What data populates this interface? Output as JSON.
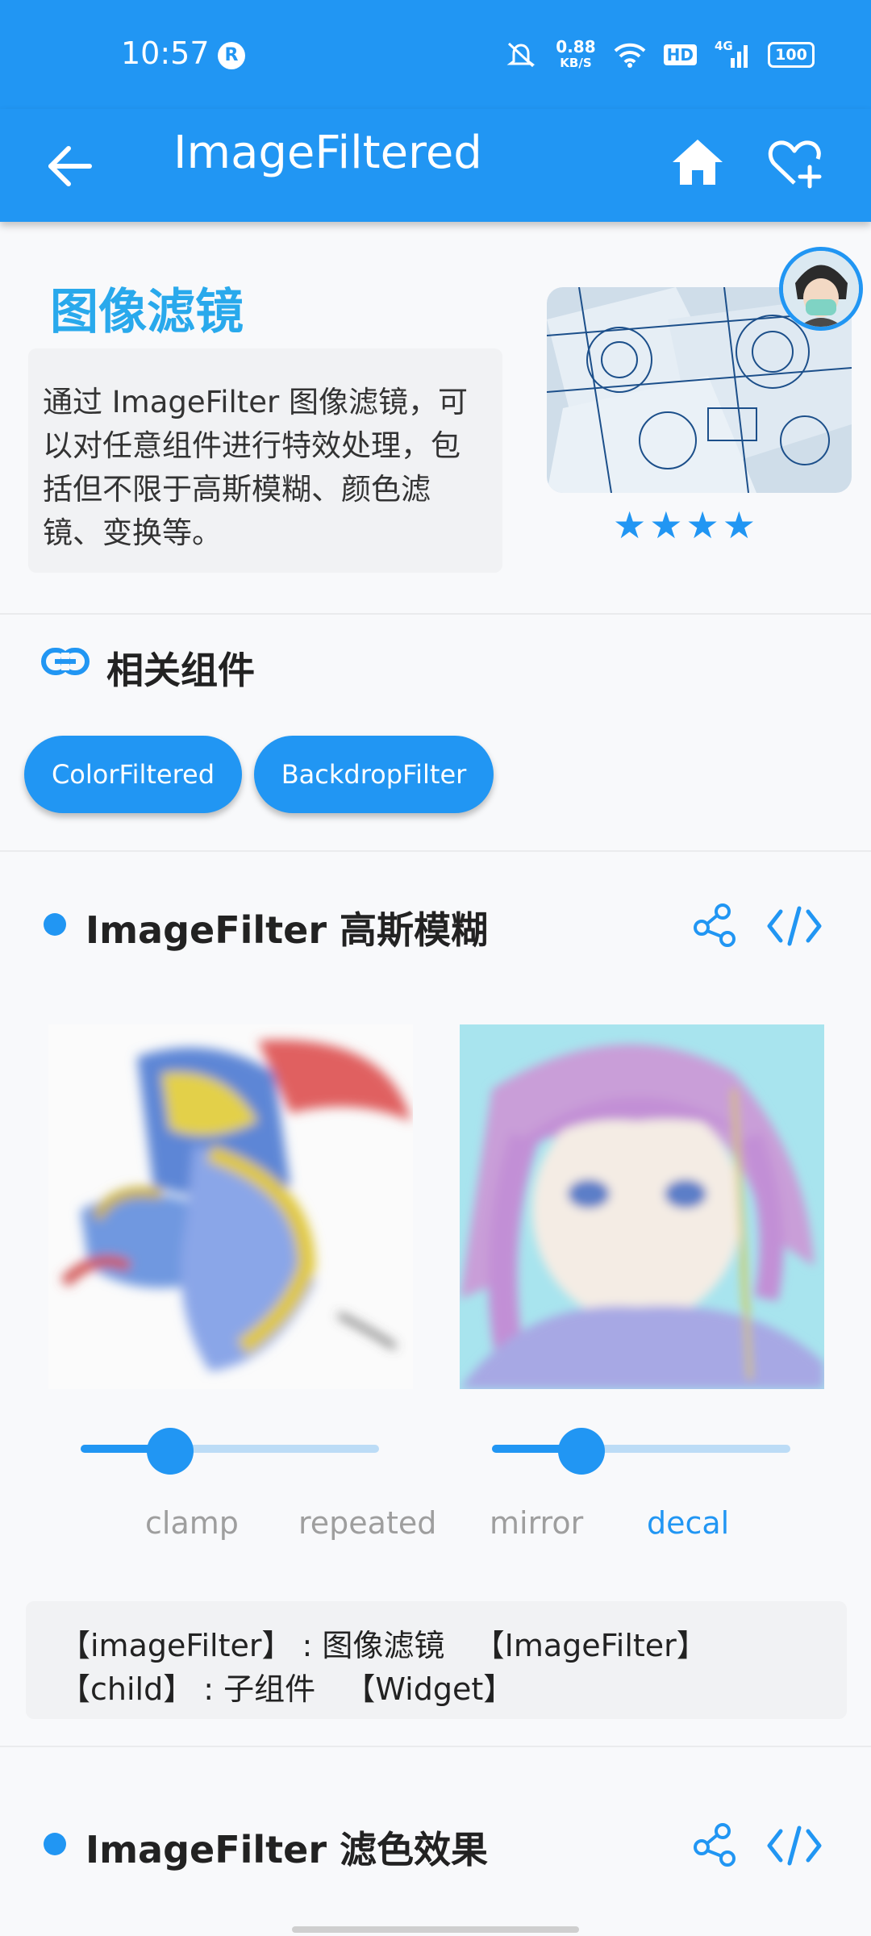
{
  "status_bar": {
    "time": "10:57",
    "net_speed_value": "0.88",
    "net_speed_unit": "KB/S",
    "hd": "HD",
    "signal": "4G",
    "battery": "100"
  },
  "app_bar": {
    "title": "ImageFiltered",
    "back_icon": "arrow-back-icon",
    "home_icon": "home-icon",
    "favorite_icon": "heart-add-icon"
  },
  "intro": {
    "title": "图像滤镜",
    "description": "通过 ImageFilter 图像滤镜，可以对任意组件进行特效处理，包括但不限于高斯模糊、颜色滤镜、变换等。",
    "rating": 4
  },
  "related": {
    "title": "相关组件",
    "chips": [
      "ColorFiltered",
      "BackdropFilter"
    ]
  },
  "demo1": {
    "title": "ImageFilter 高斯模糊",
    "slider_left_value": 0.3,
    "slider_right_value": 0.3,
    "modes": [
      "clamp",
      "repeated",
      "mirror",
      "decal"
    ],
    "active_mode": "decal",
    "props": [
      "【imageFilter】 : 图像滤镜   【ImageFilter】",
      "【child】 : 子组件   【Widget】"
    ]
  },
  "demo2": {
    "title": "ImageFilter 滤色效果"
  },
  "colors": {
    "primary": "#2196f3",
    "title_blue": "#29a9ec",
    "inactive": "#9e9e9e",
    "track": "#bcdcf6"
  }
}
